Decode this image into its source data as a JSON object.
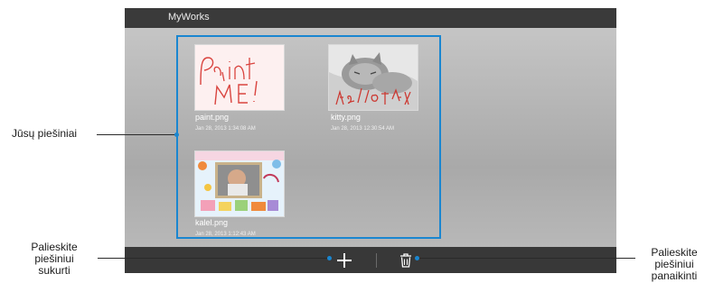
{
  "app": {
    "title": "MyWorks"
  },
  "gallery": {
    "items": [
      {
        "filename": "paint.png",
        "date": "Jan 28, 2013 1:34:08 AM"
      },
      {
        "filename": "kitty.png",
        "date": "Jan 28, 2013 12:30:54 AM"
      },
      {
        "filename": "kalel.png",
        "date": "Jan 28, 2013 1:12:43 AM"
      }
    ]
  },
  "toolbar": {
    "add_icon": "plus-icon",
    "delete_icon": "trash-icon"
  },
  "callouts": {
    "drawings": "Jūsų piešiniai",
    "create_line1": "Palieskite",
    "create_line2": "piešiniui",
    "create_line3": "sukurti",
    "delete_line1": "Palieskite",
    "delete_line2": "piešiniui",
    "delete_line3": "panaikinti"
  },
  "colors": {
    "accent": "#1a86d0",
    "title_bar": "#3a3a3a",
    "bottom_bar": "#383838"
  }
}
